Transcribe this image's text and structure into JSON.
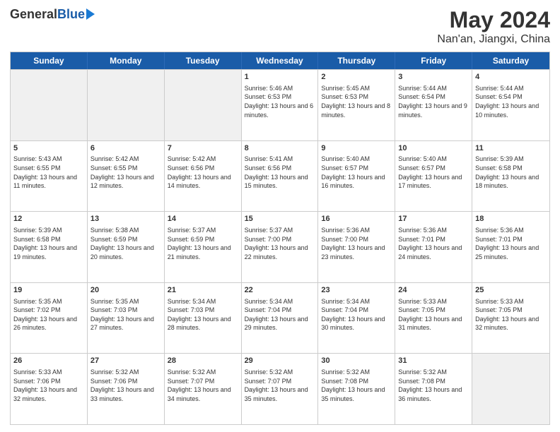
{
  "header": {
    "logo_general": "General",
    "logo_blue": "Blue",
    "title": "May 2024",
    "subtitle": "Nan'an, Jiangxi, China"
  },
  "days_of_week": [
    "Sunday",
    "Monday",
    "Tuesday",
    "Wednesday",
    "Thursday",
    "Friday",
    "Saturday"
  ],
  "rows": [
    {
      "cells": [
        {
          "day": "",
          "info": "",
          "shaded": true
        },
        {
          "day": "",
          "info": "",
          "shaded": true
        },
        {
          "day": "",
          "info": "",
          "shaded": true
        },
        {
          "day": "1",
          "info": "Sunrise: 5:46 AM\nSunset: 6:53 PM\nDaylight: 13 hours and 6 minutes.",
          "shaded": false
        },
        {
          "day": "2",
          "info": "Sunrise: 5:45 AM\nSunset: 6:53 PM\nDaylight: 13 hours and 8 minutes.",
          "shaded": false
        },
        {
          "day": "3",
          "info": "Sunrise: 5:44 AM\nSunset: 6:54 PM\nDaylight: 13 hours and 9 minutes.",
          "shaded": false
        },
        {
          "day": "4",
          "info": "Sunrise: 5:44 AM\nSunset: 6:54 PM\nDaylight: 13 hours and 10 minutes.",
          "shaded": false
        }
      ]
    },
    {
      "cells": [
        {
          "day": "5",
          "info": "Sunrise: 5:43 AM\nSunset: 6:55 PM\nDaylight: 13 hours and 11 minutes.",
          "shaded": false
        },
        {
          "day": "6",
          "info": "Sunrise: 5:42 AM\nSunset: 6:55 PM\nDaylight: 13 hours and 12 minutes.",
          "shaded": false
        },
        {
          "day": "7",
          "info": "Sunrise: 5:42 AM\nSunset: 6:56 PM\nDaylight: 13 hours and 14 minutes.",
          "shaded": false
        },
        {
          "day": "8",
          "info": "Sunrise: 5:41 AM\nSunset: 6:56 PM\nDaylight: 13 hours and 15 minutes.",
          "shaded": false
        },
        {
          "day": "9",
          "info": "Sunrise: 5:40 AM\nSunset: 6:57 PM\nDaylight: 13 hours and 16 minutes.",
          "shaded": false
        },
        {
          "day": "10",
          "info": "Sunrise: 5:40 AM\nSunset: 6:57 PM\nDaylight: 13 hours and 17 minutes.",
          "shaded": false
        },
        {
          "day": "11",
          "info": "Sunrise: 5:39 AM\nSunset: 6:58 PM\nDaylight: 13 hours and 18 minutes.",
          "shaded": false
        }
      ]
    },
    {
      "cells": [
        {
          "day": "12",
          "info": "Sunrise: 5:39 AM\nSunset: 6:58 PM\nDaylight: 13 hours and 19 minutes.",
          "shaded": false
        },
        {
          "day": "13",
          "info": "Sunrise: 5:38 AM\nSunset: 6:59 PM\nDaylight: 13 hours and 20 minutes.",
          "shaded": false
        },
        {
          "day": "14",
          "info": "Sunrise: 5:37 AM\nSunset: 6:59 PM\nDaylight: 13 hours and 21 minutes.",
          "shaded": false
        },
        {
          "day": "15",
          "info": "Sunrise: 5:37 AM\nSunset: 7:00 PM\nDaylight: 13 hours and 22 minutes.",
          "shaded": false
        },
        {
          "day": "16",
          "info": "Sunrise: 5:36 AM\nSunset: 7:00 PM\nDaylight: 13 hours and 23 minutes.",
          "shaded": false
        },
        {
          "day": "17",
          "info": "Sunrise: 5:36 AM\nSunset: 7:01 PM\nDaylight: 13 hours and 24 minutes.",
          "shaded": false
        },
        {
          "day": "18",
          "info": "Sunrise: 5:36 AM\nSunset: 7:01 PM\nDaylight: 13 hours and 25 minutes.",
          "shaded": false
        }
      ]
    },
    {
      "cells": [
        {
          "day": "19",
          "info": "Sunrise: 5:35 AM\nSunset: 7:02 PM\nDaylight: 13 hours and 26 minutes.",
          "shaded": false
        },
        {
          "day": "20",
          "info": "Sunrise: 5:35 AM\nSunset: 7:03 PM\nDaylight: 13 hours and 27 minutes.",
          "shaded": false
        },
        {
          "day": "21",
          "info": "Sunrise: 5:34 AM\nSunset: 7:03 PM\nDaylight: 13 hours and 28 minutes.",
          "shaded": false
        },
        {
          "day": "22",
          "info": "Sunrise: 5:34 AM\nSunset: 7:04 PM\nDaylight: 13 hours and 29 minutes.",
          "shaded": false
        },
        {
          "day": "23",
          "info": "Sunrise: 5:34 AM\nSunset: 7:04 PM\nDaylight: 13 hours and 30 minutes.",
          "shaded": false
        },
        {
          "day": "24",
          "info": "Sunrise: 5:33 AM\nSunset: 7:05 PM\nDaylight: 13 hours and 31 minutes.",
          "shaded": false
        },
        {
          "day": "25",
          "info": "Sunrise: 5:33 AM\nSunset: 7:05 PM\nDaylight: 13 hours and 32 minutes.",
          "shaded": false
        }
      ]
    },
    {
      "cells": [
        {
          "day": "26",
          "info": "Sunrise: 5:33 AM\nSunset: 7:06 PM\nDaylight: 13 hours and 32 minutes.",
          "shaded": false
        },
        {
          "day": "27",
          "info": "Sunrise: 5:32 AM\nSunset: 7:06 PM\nDaylight: 13 hours and 33 minutes.",
          "shaded": false
        },
        {
          "day": "28",
          "info": "Sunrise: 5:32 AM\nSunset: 7:07 PM\nDaylight: 13 hours and 34 minutes.",
          "shaded": false
        },
        {
          "day": "29",
          "info": "Sunrise: 5:32 AM\nSunset: 7:07 PM\nDaylight: 13 hours and 35 minutes.",
          "shaded": false
        },
        {
          "day": "30",
          "info": "Sunrise: 5:32 AM\nSunset: 7:08 PM\nDaylight: 13 hours and 35 minutes.",
          "shaded": false
        },
        {
          "day": "31",
          "info": "Sunrise: 5:32 AM\nSunset: 7:08 PM\nDaylight: 13 hours and 36 minutes.",
          "shaded": false
        },
        {
          "day": "",
          "info": "",
          "shaded": true
        }
      ]
    }
  ]
}
